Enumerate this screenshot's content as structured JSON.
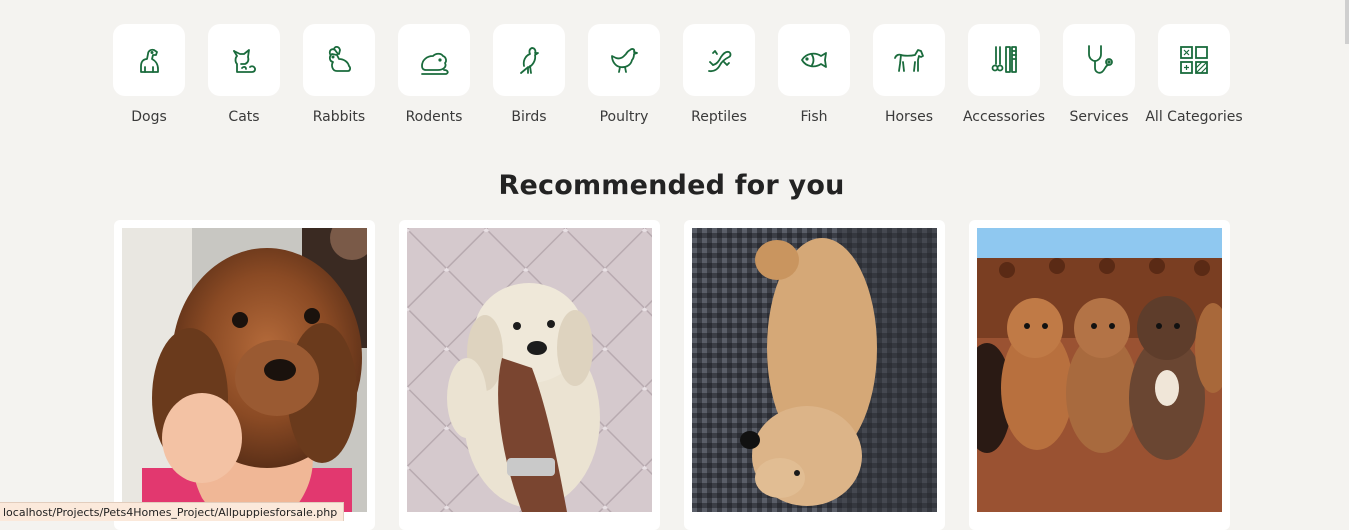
{
  "categories": [
    {
      "label": "Dogs",
      "icon": "dog-icon"
    },
    {
      "label": "Cats",
      "icon": "cat-icon"
    },
    {
      "label": "Rabbits",
      "icon": "rabbit-icon"
    },
    {
      "label": "Rodents",
      "icon": "rodent-icon"
    },
    {
      "label": "Birds",
      "icon": "bird-icon"
    },
    {
      "label": "Poultry",
      "icon": "chicken-icon"
    },
    {
      "label": "Reptiles",
      "icon": "lizard-icon"
    },
    {
      "label": "Fish",
      "icon": "fish-icon"
    },
    {
      "label": "Horses",
      "icon": "horse-icon"
    },
    {
      "label": "Accessories",
      "icon": "grooming-tools-icon"
    },
    {
      "label": "Services",
      "icon": "stethoscope-icon"
    },
    {
      "label": "All Categories",
      "icon": "grid-icon"
    }
  ],
  "recommended": {
    "heading": "Recommended for you",
    "cards": [
      {
        "photo": "red-brown puppy held in hands"
      },
      {
        "photo": "cream poodle puppy held in hand"
      },
      {
        "photo": "apricot puppy lying on sofa"
      },
      {
        "photo": "litter of cockapoo puppies on leather sofa"
      }
    ]
  },
  "status_bar": {
    "url": "localhost/Projects/Pets4Homes_Project/Allpuppiesforsale.php"
  },
  "colors": {
    "icon_green": "#1a6b3c",
    "background": "#f4f3f0"
  }
}
